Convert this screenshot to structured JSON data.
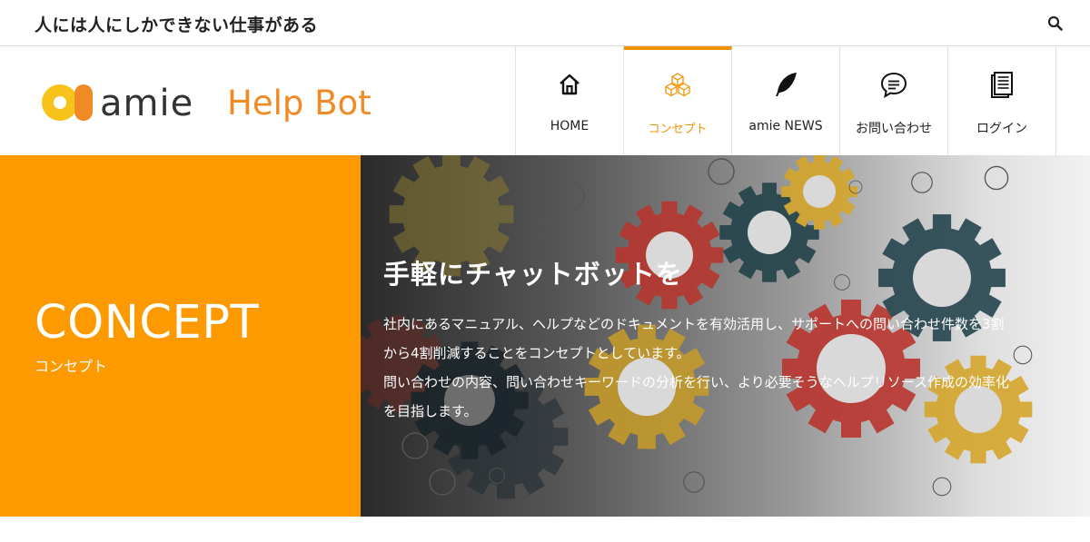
{
  "topbar": {
    "tagline": "人には人にしかできない仕事がある",
    "search_icon": "search-icon"
  },
  "logo": {
    "brand": "amie",
    "product": "Help Bot"
  },
  "nav": {
    "items": [
      {
        "label": "HOME",
        "icon": "home-icon",
        "active": false
      },
      {
        "label": "コンセプト",
        "icon": "cubes-icon",
        "active": true
      },
      {
        "label": "amie NEWS",
        "icon": "feather-icon",
        "active": false
      },
      {
        "label": "お問い合わせ",
        "icon": "chat-bubble-icon",
        "active": false
      },
      {
        "label": "ログイン",
        "icon": "document-icon",
        "active": false
      }
    ]
  },
  "hero": {
    "title": "CONCEPT",
    "subtitle": "コンセプト",
    "heading": "手軽にチャットボットを",
    "paragraph1_line1": "社内にあるマニュアル、ヘルプなどのドキュメントを有効活用し、サポートへの問い合わせ件数を3割",
    "paragraph1_line2": "から4割削減することをコンセプトとしています。",
    "paragraph2_line1": "問い合わせの内容、問い合わせキーワードの分析を行い、より必要そうなヘルプリソース作成の効率化",
    "paragraph2_line2": "を目指します。"
  },
  "colors": {
    "accent": "#f39200",
    "hero_left_bg": "#fd9a02",
    "logo_orange": "#f08a24",
    "logo_yellow": "#f7c21a"
  }
}
